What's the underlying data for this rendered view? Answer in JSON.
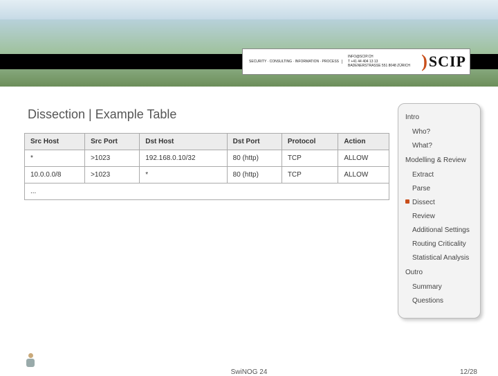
{
  "logo": {
    "text": "SCIP",
    "tagline1": "SECURITY · CONSULTING · INFORMATION · PROCESS",
    "tagline2": "INFO@SCIP.CH",
    "tagline3": "T +41 44 404 13 13",
    "tagline4": "BADENERSTRASSE 551  8048 ZÜRICH"
  },
  "slide": {
    "title": "Dissection | Example Table"
  },
  "table": {
    "headers": [
      "Src Host",
      "Src Port",
      "Dst Host",
      "Dst Port",
      "Protocol",
      "Action"
    ],
    "rows": [
      [
        "*",
        ">1023",
        "192.168.0.10/32",
        "80 (http)",
        "TCP",
        "ALLOW"
      ],
      [
        "10.0.0.0/8",
        ">1023",
        "*",
        "80 (http)",
        "TCP",
        "ALLOW"
      ]
    ],
    "ellipsis": "..."
  },
  "nav": {
    "items": [
      {
        "label": "Intro",
        "level": 0
      },
      {
        "label": "Who?",
        "level": 1
      },
      {
        "label": "What?",
        "level": 1
      },
      {
        "label": "Modelling & Review",
        "level": 0
      },
      {
        "label": "Extract",
        "level": 1
      },
      {
        "label": "Parse",
        "level": 1
      },
      {
        "label": "Dissect",
        "level": 1,
        "current": true
      },
      {
        "label": "Review",
        "level": 1
      },
      {
        "label": "Additional Settings",
        "level": 1
      },
      {
        "label": "Routing Criticality",
        "level": 1
      },
      {
        "label": "Statistical Analysis",
        "level": 1
      },
      {
        "label": "Outro",
        "level": 0
      },
      {
        "label": "Summary",
        "level": 1
      },
      {
        "label": "Questions",
        "level": 1
      }
    ]
  },
  "footer": {
    "center": "SwiNOG 24",
    "page": "12/28"
  }
}
